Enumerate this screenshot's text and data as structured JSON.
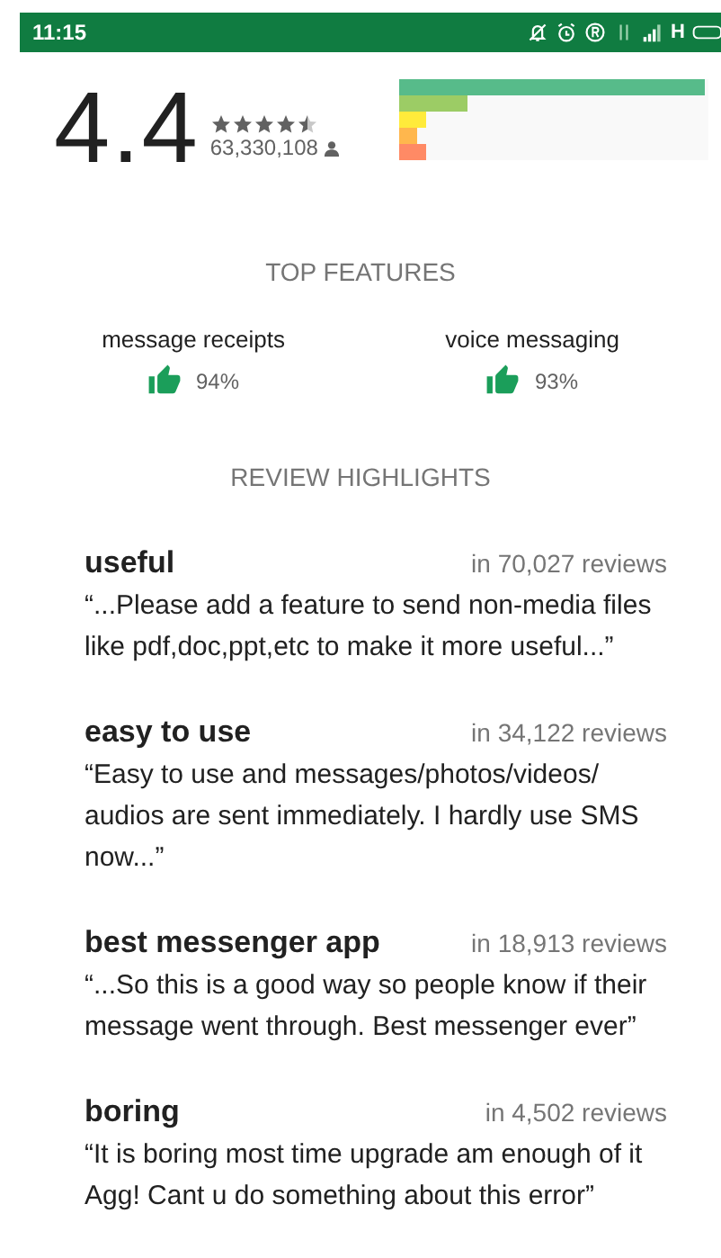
{
  "status_bar": {
    "time": "11:15",
    "network": "H"
  },
  "rating": {
    "score": "4.4",
    "stars": 4.5,
    "count": "63,330,108"
  },
  "histogram": [
    {
      "level": 0.99,
      "color": "#57bb8a"
    },
    {
      "level": 0.22,
      "color": "#9ccc65"
    },
    {
      "level": 0.09,
      "color": "#ffeb3b"
    },
    {
      "level": 0.06,
      "color": "#ffb74d"
    },
    {
      "level": 0.09,
      "color": "#ff8a65"
    }
  ],
  "top_features": {
    "heading": "TOP FEATURES",
    "items": [
      {
        "name": "message receipts",
        "percent": "94%"
      },
      {
        "name": "voice messaging",
        "percent": "93%"
      }
    ]
  },
  "review_highlights": {
    "heading": "REVIEW HIGHLIGHTS",
    "items": [
      {
        "title": "useful",
        "count": "in 70,027 reviews",
        "quote": "“...Please add a feature to send non-media files like pdf,doc,ppt,etc to make it more useful...”"
      },
      {
        "title": "easy to use",
        "count": "in 34,122 reviews",
        "quote": "“Easy to use and messages/photos/videos/ audios are sent immediately. I hardly use SMS now...”"
      },
      {
        "title": "best messenger app",
        "count": "in 18,913 reviews",
        "quote": "“...So this is a good way so people know if their message went through. Best messenger ever”"
      },
      {
        "title": "boring",
        "count": "in 4,502 reviews",
        "quote": "“It is boring most time upgrade am enough of it Agg! Cant u do something about this error”"
      }
    ]
  }
}
